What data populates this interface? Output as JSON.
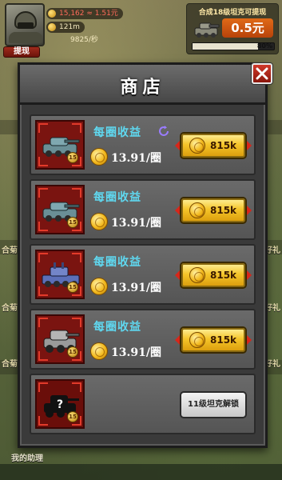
{
  "hud": {
    "gold_line": "15,162 ≈ 1.51元",
    "coins": "121m",
    "rate": "9825/秒",
    "withdraw_label": "提现"
  },
  "reward": {
    "title": "合成18级坦克可提现",
    "amount": "0.5元",
    "progress_label": "80%",
    "progress_value": 0.8
  },
  "side_labels": {
    "left1": "合菊",
    "left2": "合菊",
    "left3": "合菊",
    "right1": "好礼",
    "right2": "好礼",
    "right3": "好礼"
  },
  "shop": {
    "title": "商店",
    "items": [
      {
        "earn_label": "每圈收益",
        "income": "13.91/圈",
        "price": "815k",
        "level": "15"
      },
      {
        "earn_label": "每圈收益",
        "income": "13.91/圈",
        "price": "815k",
        "level": "15"
      },
      {
        "earn_label": "每圈收益",
        "income": "13.91/圈",
        "price": "815k",
        "level": "15"
      },
      {
        "earn_label": "每圈收益",
        "income": "13.91/圈",
        "price": "815k",
        "level": "15"
      }
    ],
    "locked_item": {
      "level": "15",
      "unlock_label": "11级坦克解锁",
      "mystery": "?"
    }
  },
  "footer": {
    "helper_label": "我的助理"
  },
  "colors": {
    "earn_label": "#5fd8f0",
    "thumb_bg": "#7a1410",
    "button_gold": "#f5c52a"
  }
}
